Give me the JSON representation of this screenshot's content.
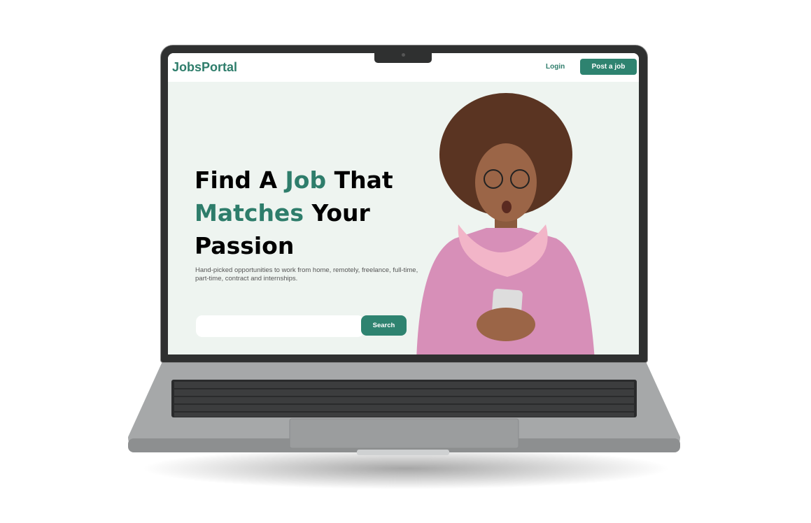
{
  "nav": {
    "logo": "JobsPortal",
    "login": "Login",
    "post_job": "Post a job"
  },
  "hero": {
    "title_1": "Find A ",
    "title_highlight_1": "Job",
    "title_2": " That ",
    "title_highlight_2": "Matches",
    "title_3": " Your Passion",
    "subtitle": "Hand-picked opportunities to work from home, remotely, freelance, full-time, part-time, contract and internships.",
    "search_placeholder": "",
    "search_button": "Search"
  },
  "colors": {
    "brand": "#2e7d6b",
    "hero_bg": "#eef4f0"
  }
}
